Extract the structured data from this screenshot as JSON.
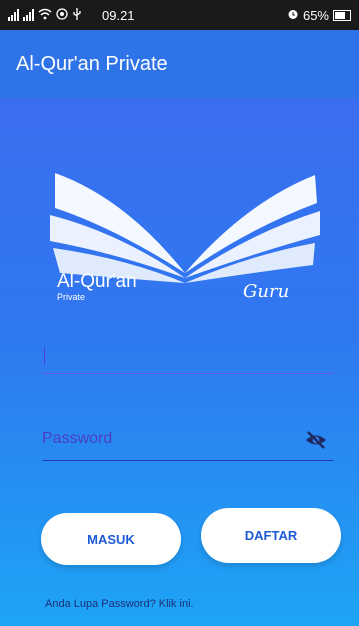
{
  "status_bar": {
    "time": "09.21",
    "battery": "65%",
    "icons": [
      "signal-icon",
      "signal-icon",
      "wifi-icon",
      "hotspot-icon",
      "usb-icon",
      "alarm-icon",
      "battery-icon"
    ]
  },
  "app_bar": {
    "title": "Al-Qur'an Private"
  },
  "logo": {
    "name": "Al-Qur'an",
    "sub": "Private",
    "role": "Guru"
  },
  "form": {
    "username": {
      "label": "",
      "value": ""
    },
    "password": {
      "placeholder": "Password",
      "value": ""
    }
  },
  "buttons": {
    "login": "MASUK",
    "register": "DAFTAR"
  },
  "forgot_text": "Anda Lupa Password? Klik ini.",
  "colors": {
    "app_bar": "#2e74e8",
    "gradient_top": "#3a6ef0",
    "gradient_bottom": "#1da5f5",
    "button_text": "#1e5bd6"
  }
}
